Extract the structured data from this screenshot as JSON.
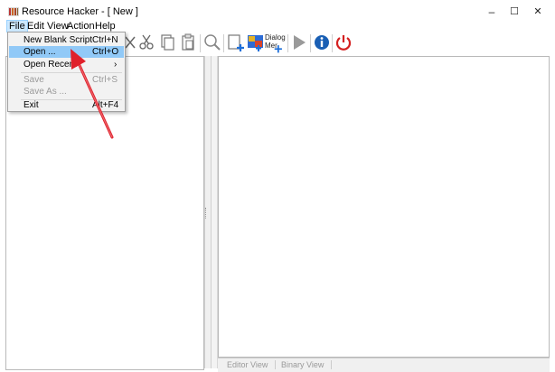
{
  "window": {
    "title": "Resource Hacker - [ New ]",
    "minimize_glyph": "–",
    "maximize_glyph": "☐",
    "close_glyph": "✕"
  },
  "menubar": {
    "items": [
      {
        "label": "File"
      },
      {
        "label": "Edit"
      },
      {
        "label": "View"
      },
      {
        "label": "Action"
      },
      {
        "label": "Help"
      }
    ]
  },
  "file_menu": {
    "items": [
      {
        "label": "New Blank Script",
        "shortcut": "Ctrl+N"
      },
      {
        "label": "Open ...",
        "shortcut": "Ctrl+O"
      },
      {
        "label": "Open Recent",
        "shortcut": "›"
      },
      {
        "label": "Save",
        "shortcut": "Ctrl+S"
      },
      {
        "label": "Save As ...",
        "shortcut": ""
      },
      {
        "label": "Exit",
        "shortcut": "Alt+F4"
      }
    ]
  },
  "toolbar": {
    "dialog_label_1": "Dialog",
    "dialog_label_2": "Mer",
    "icons": [
      "scissors-icon",
      "copy-icon",
      "paste-icon",
      "find-icon",
      "add-resource-icon",
      "image-resource-icon",
      "dialog-merge-icon",
      "run-script-icon",
      "info-icon",
      "power-icon"
    ]
  },
  "bottom_tabs": {
    "editor_view": "Editor View",
    "binary_view": "Binary View"
  },
  "colors": {
    "menu_highlight": "#91c9f7",
    "active_menu": "#cce8ff",
    "annotation_arrow": "#e0202a",
    "info_blue": "#1a5fb4",
    "power_red": "#d42020"
  }
}
